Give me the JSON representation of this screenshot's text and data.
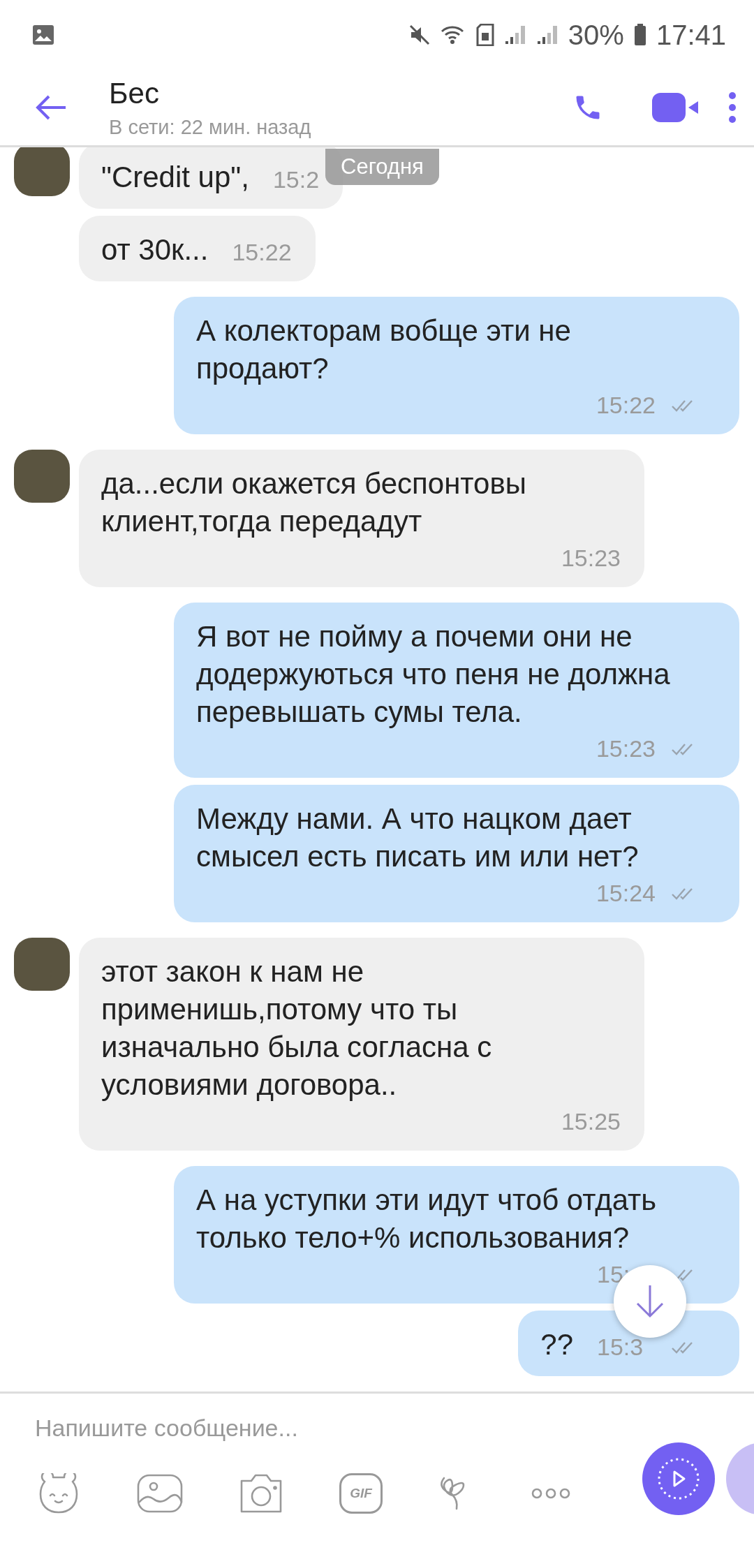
{
  "status_bar": {
    "battery": "30%",
    "time": "17:41"
  },
  "header": {
    "title": "Бес",
    "subtitle": "В сети: 22 мин. назад"
  },
  "date_badge": "Сегодня",
  "messages": [
    {
      "kind": "incoming",
      "avatar": true,
      "text": "\"Credit up\",",
      "time": "15:2"
    },
    {
      "kind": "incoming",
      "avatar": false,
      "text": "от 30к...",
      "time": "15:22"
    },
    {
      "kind": "outgoing",
      "text": "А колекторам вобще эти не продают?",
      "time": "15:22"
    },
    {
      "kind": "incoming",
      "avatar": true,
      "text": "да...если окажется беспонтовы клиент,тогда передадут",
      "time": "15:23"
    },
    {
      "kind": "outgoing",
      "text": "Я вот не пойму а почеми они не додержуються что пеня не должна перевышать сумы тела.",
      "time": "15:23"
    },
    {
      "kind": "outgoing",
      "text": "Между нами. А что нацком дает смысел есть писать им или нет?",
      "time": "15:24"
    },
    {
      "kind": "incoming",
      "avatar": true,
      "text": "этот закон к нам не применишь,потому что ты изначально была согласна с условиями договора..",
      "time": "15:25"
    },
    {
      "kind": "outgoing",
      "text": "А на уступки эти идут чтоб отдать только тело+% использования?",
      "time": "15:"
    },
    {
      "kind": "outgoing",
      "text": "??",
      "time": "15:3"
    }
  ],
  "composer": {
    "placeholder": "Напишите сообщение...",
    "gif_label": "GIF"
  }
}
